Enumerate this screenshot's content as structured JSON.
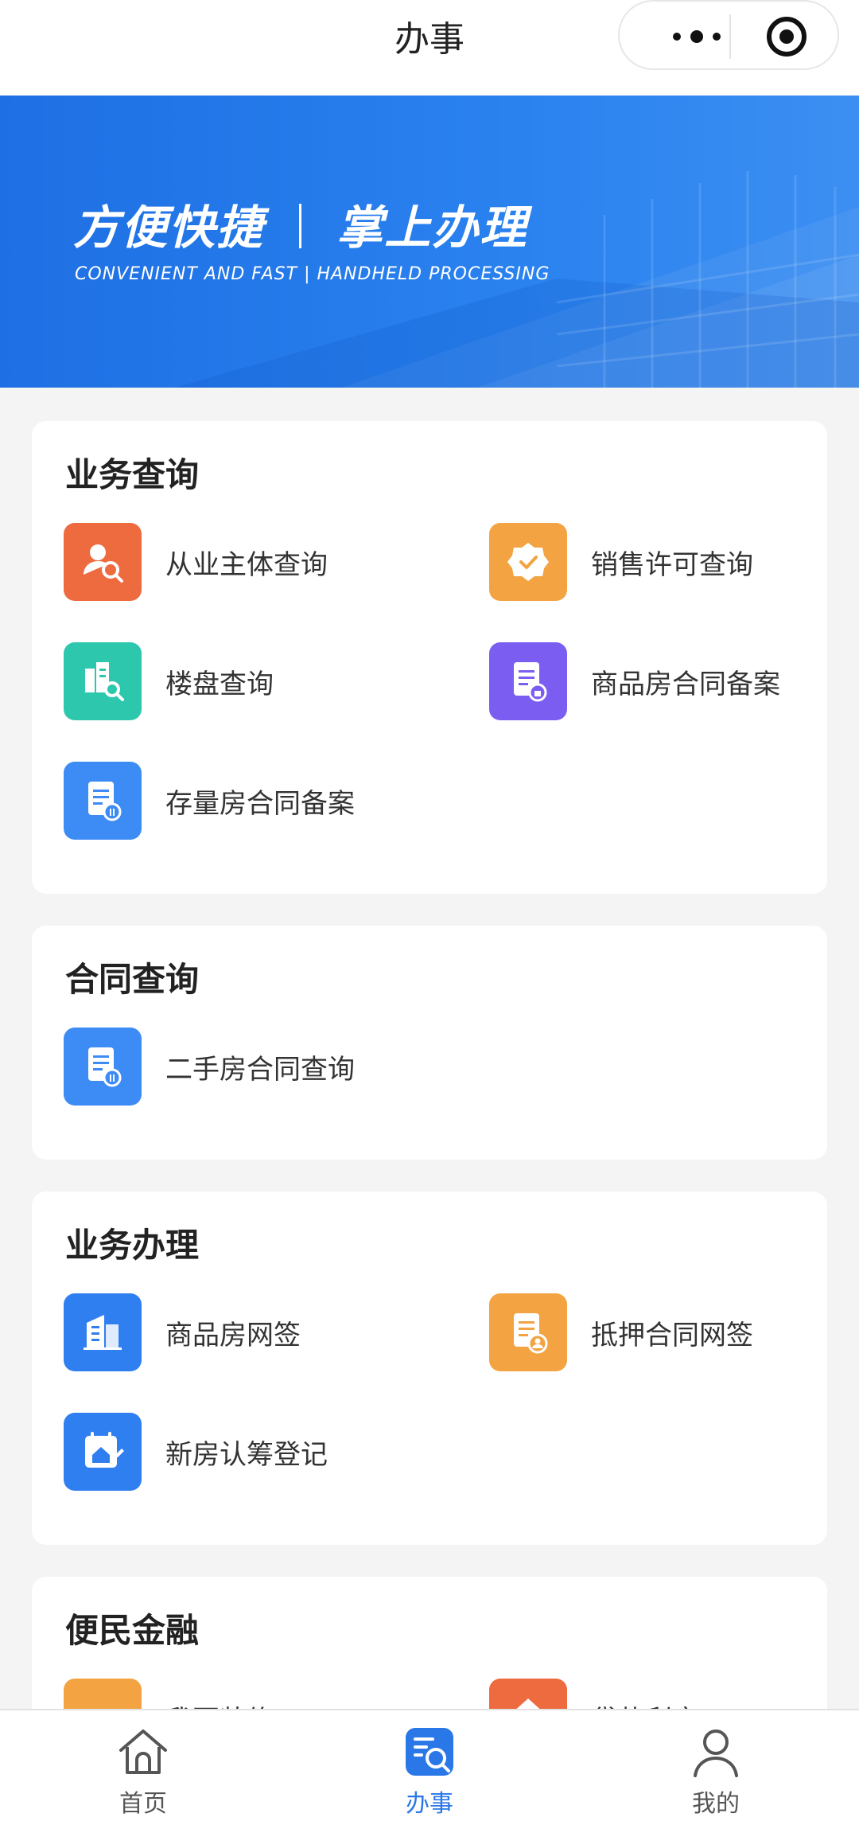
{
  "nav": {
    "title": "办事"
  },
  "banner": {
    "headline_left": "方便快捷",
    "headline_right": "掌上办理",
    "subtitle": "CONVENIENT AND FAST | HANDHELD PROCESSING"
  },
  "sections": {
    "business_query": {
      "title": "业务查询",
      "items": [
        {
          "label": "从业主体查询",
          "icon": "user-search-icon",
          "color": "#ee6a3f"
        },
        {
          "label": "销售许可查询",
          "icon": "badge-check-icon",
          "color": "#f3a341"
        },
        {
          "label": "楼盘查询",
          "icon": "building-search-icon",
          "color": "#2dc7ad"
        },
        {
          "label": "商品房合同备案",
          "icon": "contract-lock-icon",
          "color": "#7c5df2"
        },
        {
          "label": "存量房合同备案",
          "icon": "document-icon",
          "color": "#3d8bf5"
        }
      ]
    },
    "contract_query": {
      "title": "合同查询",
      "items": [
        {
          "label": "二手房合同查询",
          "icon": "document-icon",
          "color": "#3d8bf5"
        }
      ]
    },
    "business_handle": {
      "title": "业务办理",
      "items": [
        {
          "label": "商品房网签",
          "icon": "building-icon",
          "color": "#2f7ff0"
        },
        {
          "label": "抵押合同网签",
          "icon": "document-user-icon",
          "color": "#f3a341"
        },
        {
          "label": "新房认筹登记",
          "icon": "calendar-home-icon",
          "color": "#2f7ff0"
        }
      ]
    },
    "finance": {
      "title": "便民金融",
      "items": [
        {
          "label": "我要装修",
          "icon": "tool-icon",
          "color": "#f3a341"
        },
        {
          "label": "贷款利率",
          "icon": "rate-icon",
          "color": "#ee6a3f"
        }
      ]
    }
  },
  "tabbar": {
    "home": "首页",
    "work": "办事",
    "mine": "我的",
    "active_color": "#2a77e8"
  }
}
